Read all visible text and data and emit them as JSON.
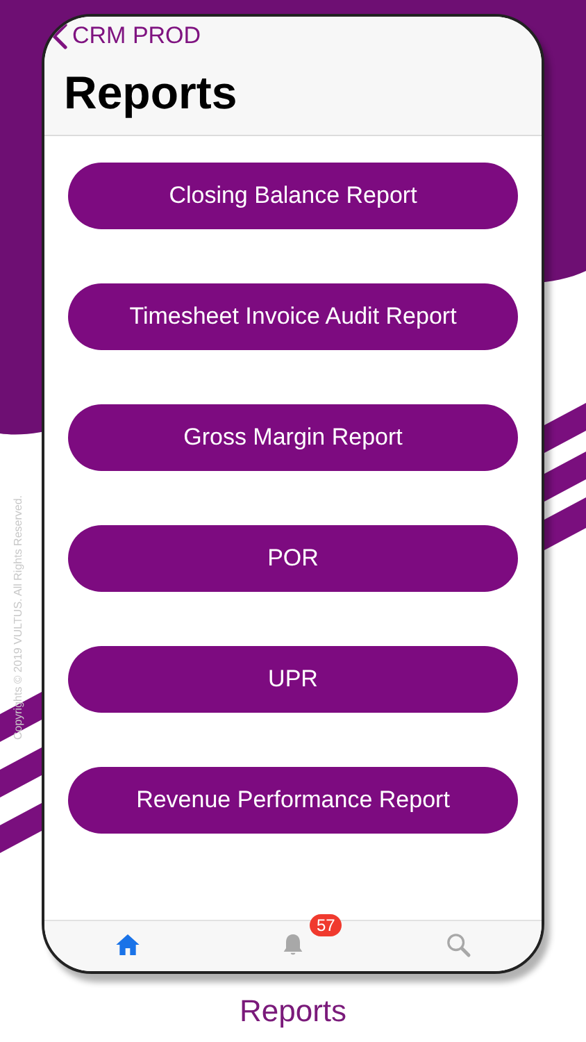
{
  "nav": {
    "back_label": "CRM PROD",
    "title": "Reports"
  },
  "reports": [
    {
      "label": "Closing Balance Report"
    },
    {
      "label": "Timesheet Invoice Audit Report"
    },
    {
      "label": "Gross Margin Report"
    },
    {
      "label": "POR"
    },
    {
      "label": "UPR"
    },
    {
      "label": "Revenue Performance Report"
    }
  ],
  "tab_bar": [
    {
      "kind": "home",
      "selected": true
    },
    {
      "kind": "notifications",
      "selected": false,
      "badge": "57"
    },
    {
      "kind": "search",
      "selected": false
    }
  ],
  "caption": "Reports",
  "copyright": "Copyrights © 2019 VULTUS. All Rights Reserved."
}
